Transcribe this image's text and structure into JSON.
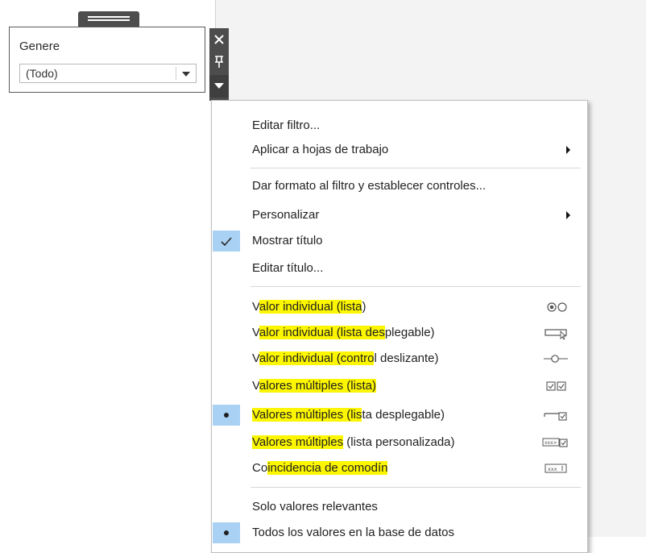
{
  "filter": {
    "title": "Genere",
    "selected_value": "(Todo)"
  },
  "menu": {
    "edit_filter": "Editar filtro...",
    "apply_to_worksheets": "Aplicar a hojas de trabajo",
    "format_filter": "Dar formato al filtro y establecer controles...",
    "customize": "Personalizar",
    "show_title": "Mostrar título",
    "edit_title": "Editar título...",
    "modes": [
      {
        "pre": "V",
        "hl": "alor individual (lista",
        "post": ")"
      },
      {
        "pre": "V",
        "hl": "alor individual (lista des",
        "post": "plegable)"
      },
      {
        "pre": "V",
        "hl": "alor individual (contro",
        "post": "l deslizante)"
      },
      {
        "pre": "V",
        "hl": "alores múltiples (lista)",
        "post": ""
      },
      {
        "pre": "",
        "hl": "Valores múltiples (lis",
        "post": "ta desplegable)"
      },
      {
        "pre": "",
        "hl": "Valores múltiples",
        "post": " (lista personalizada)"
      },
      {
        "pre": "Co",
        "hl": "incidencia de comodín",
        "post": ""
      }
    ],
    "relevant_only": "Solo valores relevantes",
    "all_in_db": "Todos los valores en la base de datos"
  },
  "colors": {
    "highlight": "#fcf600",
    "check_background": "#a9d1f3",
    "toolbar": "#4d4d4d"
  },
  "icons": {
    "close": "close-icon",
    "pin": "pin-icon",
    "menu": "menu-dropdown-icon"
  }
}
